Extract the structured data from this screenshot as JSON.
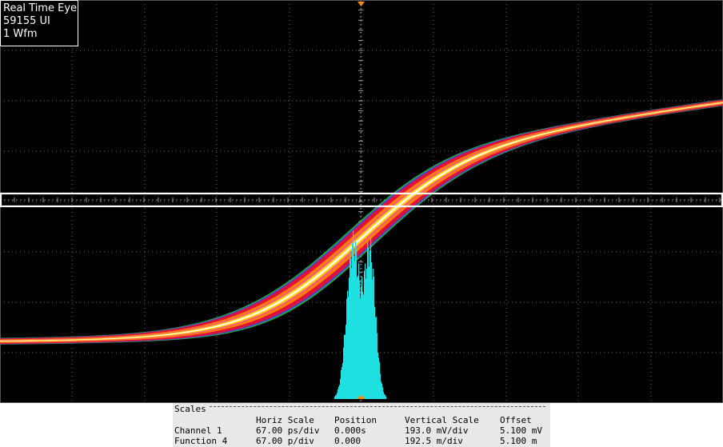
{
  "window": {
    "background": "#000000",
    "grid_color": "#6a6a6a",
    "eye_colors": [
      "#ffffff",
      "#ffd400",
      "#ff8c00",
      "#e0103a",
      "#ff40c0",
      "#3040ff",
      "#30c030"
    ],
    "histogram_color": "#1fe0e0",
    "marker_color": "#ff8a00"
  },
  "info_box": {
    "line1": "Real Time Eye",
    "line2": "59155 UI",
    "line3": "1 Wfm"
  },
  "scales": {
    "title": "Scales",
    "headers": {
      "horiz": "Horiz Scale",
      "position": "Position",
      "vertical": "Vertical Scale",
      "offset": "Offset"
    },
    "rows": [
      {
        "name": "Channel 1",
        "horiz": "67.00 ps/div",
        "position": "0.000s",
        "vertical": "193.0 mV/div",
        "offset": "5.100 mV"
      },
      {
        "name": "Function 4",
        "horiz": "67.00 p/div",
        "position": "0.000",
        "vertical": "192.5 m/div",
        "offset": "5.100 m"
      }
    ]
  },
  "icons": {
    "top_marker": "trigger-position-marker-icon",
    "bottom_marker": "histogram-center-marker-icon"
  }
}
